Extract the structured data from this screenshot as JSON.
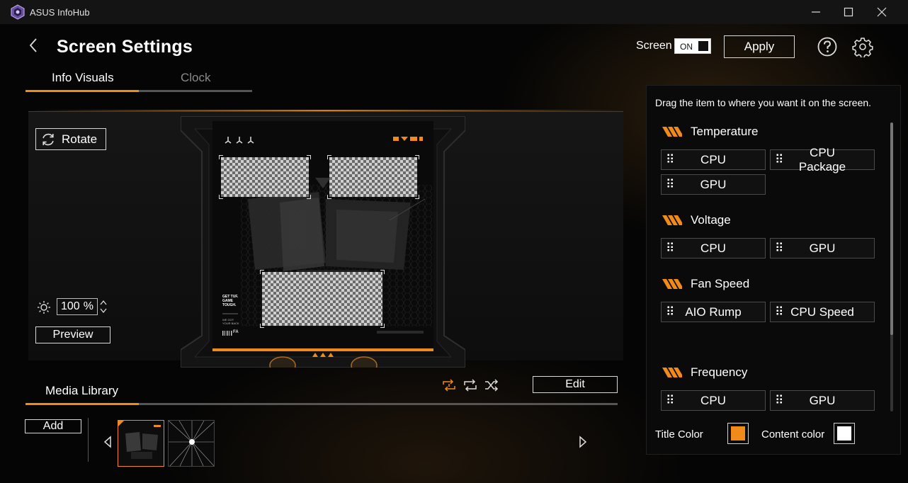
{
  "app": {
    "title": "ASUS InfoHub"
  },
  "header": {
    "title": "Screen Settings",
    "screen_label": "Screen",
    "screen_toggle": "ON",
    "apply_label": "Apply"
  },
  "tabs": [
    {
      "label": "Info Visuals",
      "active": true
    },
    {
      "label": "Clock",
      "active": false
    }
  ],
  "preview": {
    "rotate_label": "Rotate",
    "brightness_value": "100",
    "brightness_unit": "%",
    "preview_label": "Preview"
  },
  "lcd_text": {
    "line1": "GET TUF.",
    "line2": "GAME",
    "line3": "TOUGH.",
    "line4": "WE GOT",
    "line5": "YOUR BACK",
    "line6": "FA"
  },
  "media": {
    "tab_label": "Media Library",
    "edit_label": "Edit",
    "add_label": "Add"
  },
  "right_panel": {
    "hint": "Drag the item to where you want it on the screen.",
    "sections": [
      {
        "title": "Temperature",
        "items": [
          "CPU",
          "CPU Package",
          "GPU"
        ]
      },
      {
        "title": "Voltage",
        "items": [
          "CPU",
          "GPU"
        ]
      },
      {
        "title": "Fan Speed",
        "items": [
          "AIO Rump",
          "CPU Speed"
        ]
      },
      {
        "title": "Frequency",
        "items": [
          "CPU",
          "GPU"
        ]
      }
    ],
    "title_color_label": "Title Color",
    "content_color_label": "Content color",
    "title_color": "#f08a1a",
    "content_color": "#ffffff"
  },
  "colors": {
    "accent": "#f08a1a"
  }
}
